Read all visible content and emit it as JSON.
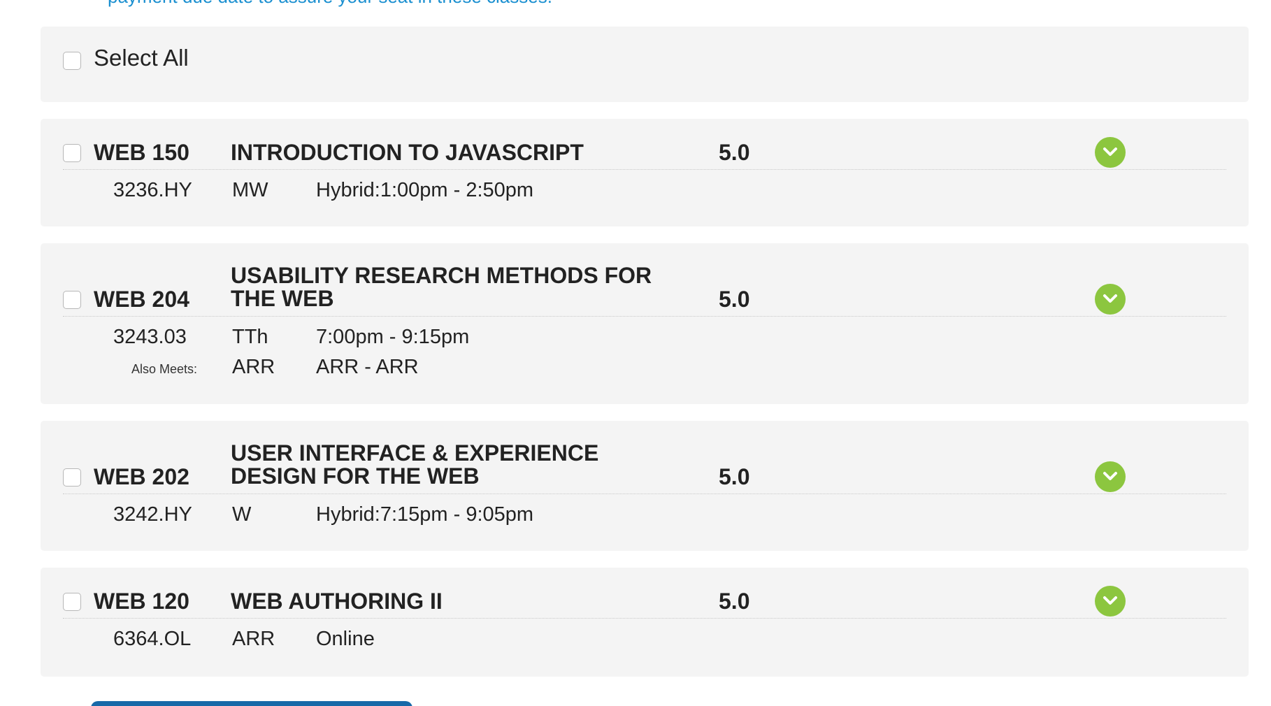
{
  "notice": "payment due date to assure your seat in these classes.",
  "select_all_label": "Select All",
  "courses": [
    {
      "code": "WEB 150",
      "title": "INTRODUCTION TO JAVASCRIPT",
      "units": "5.0",
      "meetings": [
        {
          "section": "3236.HY",
          "days": "MW",
          "time": "Hybrid:1:00pm - 2:50pm"
        }
      ]
    },
    {
      "code": "WEB 204",
      "title": "USABILITY RESEARCH METHODS FOR THE WEB",
      "units": "5.0",
      "meetings": [
        {
          "section": "3243.03",
          "days": "TTh",
          "time": "7:00pm - 9:15pm"
        },
        {
          "label": "Also Meets:",
          "days": "ARR",
          "time": "ARR - ARR"
        }
      ]
    },
    {
      "code": "WEB 202",
      "title": "USER INTERFACE & EXPERIENCE DESIGN FOR THE WEB",
      "units": "5.0",
      "meetings": [
        {
          "section": "3242.HY",
          "days": "W",
          "time": "Hybrid:7:15pm - 9:05pm"
        }
      ]
    },
    {
      "code": "WEB 120",
      "title": "WEB AUTHORING II",
      "units": "5.0",
      "meetings": [
        {
          "section": "6364.OL",
          "days": "ARR",
          "time": "Online"
        }
      ]
    }
  ],
  "colors": {
    "link": "#1a8fd0",
    "panel_bg": "#f4f4f4",
    "expand_green": "#8cc63f",
    "button_blue": "#1769a8"
  },
  "icons": {
    "expand": "chevron-down-icon"
  }
}
